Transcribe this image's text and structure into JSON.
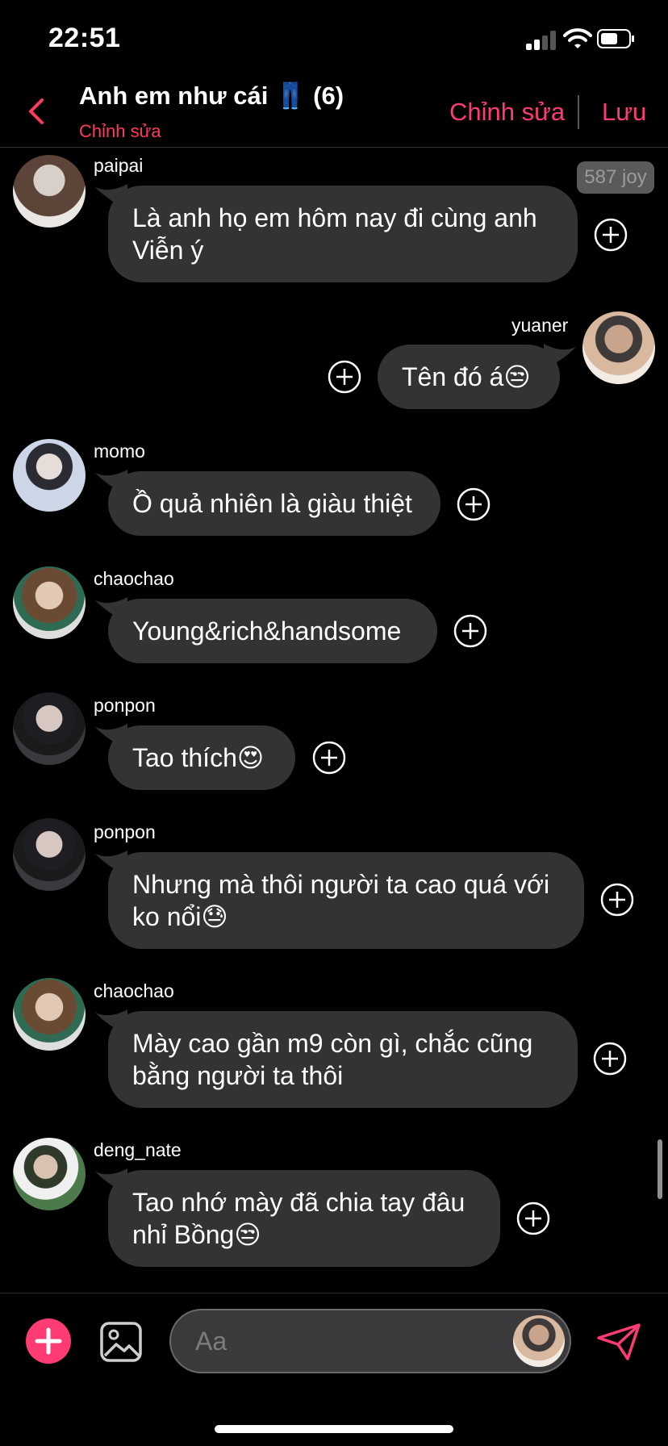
{
  "status": {
    "time": "22:51"
  },
  "header": {
    "title": "Anh em như cái 👖 (6)",
    "subtitle": "Chỉnh sửa",
    "edit_label": "Chỉnh sửa",
    "save_label": "Lưu"
  },
  "badge": {
    "joy": "587 joy"
  },
  "messages": [
    {
      "sender": "paipai",
      "text": "Là anh họ em hôm nay đi cùng anh\nViễn ý",
      "outgoing": false
    },
    {
      "sender": "yuaner",
      "text": "Tên đó á😒",
      "outgoing": true
    },
    {
      "sender": "momo",
      "text": "Ồ quả nhiên là giàu thiệt",
      "outgoing": false
    },
    {
      "sender": "chaochao",
      "text": "Young&rich&handsome",
      "outgoing": false
    },
    {
      "sender": "ponpon",
      "text": "Tao thích😍",
      "outgoing": false
    },
    {
      "sender": "ponpon",
      "text": "Nhưng mà thôi người ta cao quá với\nko nổi😓",
      "outgoing": false
    },
    {
      "sender": "chaochao",
      "text": "Mày cao gần m9 còn gì, chắc cũng\nbằng người ta thôi",
      "outgoing": false
    },
    {
      "sender": "deng_nate",
      "text": "Tao nhớ mày đã chia tay đâu\nnhỉ Bồng😒",
      "outgoing": false
    }
  ],
  "composer": {
    "placeholder": "Aa"
  },
  "colors": {
    "accent": "#ff3b74",
    "bubble": "#333335",
    "background": "#000000"
  },
  "icons": [
    "back-chevron-icon",
    "plus-circle-icon",
    "image-icon",
    "send-icon",
    "add-icon"
  ]
}
